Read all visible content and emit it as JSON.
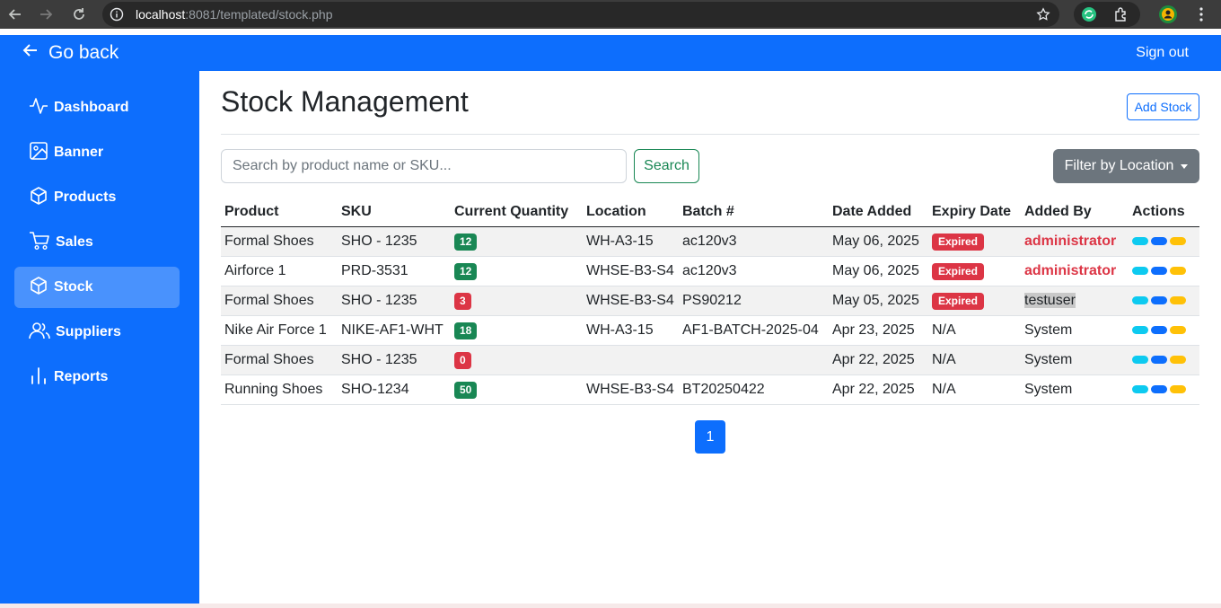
{
  "browser": {
    "url_host": "localhost",
    "url_rest": ":8081/templated/stock.php"
  },
  "topbar": {
    "go_back": "Go back",
    "sign_out": "Sign out"
  },
  "sidebar": {
    "items": [
      {
        "label": "Dashboard",
        "icon": "activity-icon"
      },
      {
        "label": "Banner",
        "icon": "image-icon"
      },
      {
        "label": "Products",
        "icon": "box-icon"
      },
      {
        "label": "Sales",
        "icon": "cart-icon"
      },
      {
        "label": "Stock",
        "icon": "box-icon",
        "active": true
      },
      {
        "label": "Suppliers",
        "icon": "users-icon"
      },
      {
        "label": "Reports",
        "icon": "bar-chart-icon"
      }
    ]
  },
  "main": {
    "title": "Stock Management",
    "add_stock": "Add Stock",
    "search_placeholder": "Search by product name or SKU...",
    "search_button": "Search",
    "filter_button": "Filter by Location",
    "columns": [
      "Product",
      "SKU",
      "Current Quantity",
      "Location",
      "Batch #",
      "Date Added",
      "Expiry Date",
      "Added By",
      "Actions"
    ],
    "rows": [
      {
        "product": "Formal Shoes",
        "sku": "SHO - 1235",
        "qty": "12",
        "qty_color": "#198754",
        "location": "WH-A3-15",
        "batch": "ac120v3",
        "date_added": "May 06, 2025",
        "expiry": "Expired",
        "added_by": "administrator",
        "added_style": "admin"
      },
      {
        "product": "Airforce 1",
        "sku": "PRD-3531",
        "qty": "12",
        "qty_color": "#198754",
        "location": "WHSE-B3-S4",
        "batch": "ac120v3",
        "date_added": "May 06, 2025",
        "expiry": "Expired",
        "added_by": "administrator",
        "added_style": "admin"
      },
      {
        "product": "Formal Shoes",
        "sku": "SHO - 1235",
        "qty": "3",
        "qty_color": "#dc3545",
        "location": "WHSE-B3-S4",
        "batch": "PS90212",
        "date_added": "May 05, 2025",
        "expiry": "Expired",
        "added_by": "testuser",
        "added_style": "highlight"
      },
      {
        "product": "Nike Air Force 1",
        "sku": "NIKE-AF1-WHT",
        "qty": "18",
        "qty_color": "#198754",
        "location": "WH-A3-15",
        "batch": "AF1-BATCH-2025-04",
        "date_added": "Apr 23, 2025",
        "expiry": "N/A",
        "added_by": "System",
        "added_style": "plain"
      },
      {
        "product": "Formal Shoes",
        "sku": "SHO - 1235",
        "qty": "0",
        "qty_color": "#dc3545",
        "location": "",
        "batch": "",
        "date_added": "Apr 22, 2025",
        "expiry": "N/A",
        "added_by": "System",
        "added_style": "plain"
      },
      {
        "product": "Running Shoes",
        "sku": "SHO-1234",
        "qty": "50",
        "qty_color": "#198754",
        "location": "WHSE-B3-S4",
        "batch": "BT20250422",
        "date_added": "Apr 22, 2025",
        "expiry": "N/A",
        "added_by": "System",
        "added_style": "plain"
      }
    ],
    "pagination": {
      "current_page": "1"
    }
  }
}
